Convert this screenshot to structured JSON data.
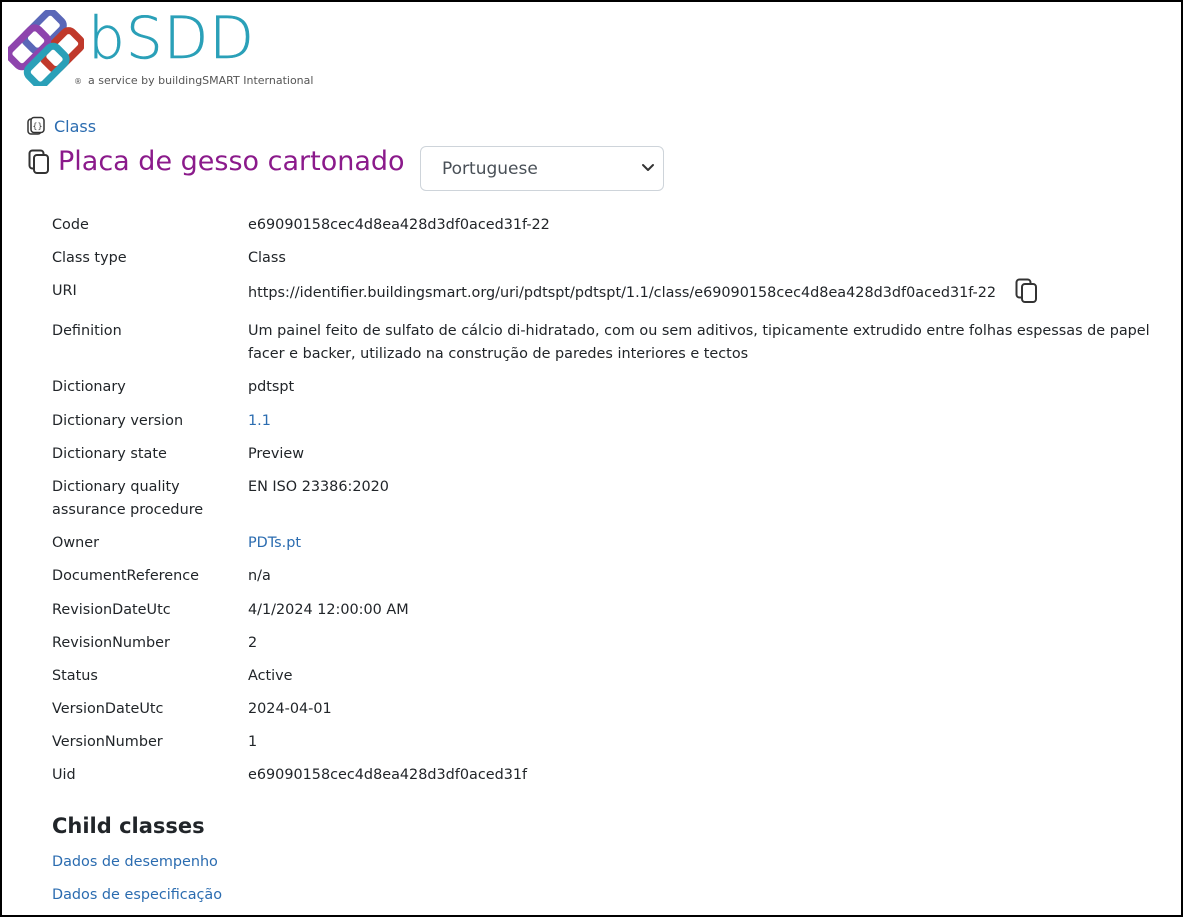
{
  "brand": {
    "name": "bSDD",
    "reg_mark": "®",
    "tagline": "a service by buildingSMART International"
  },
  "breadcrumb": {
    "label": "Class"
  },
  "class_title": "Placa de gesso cartonado",
  "language_select": {
    "selected": "Portuguese"
  },
  "properties": [
    {
      "key": "Code",
      "value": "e69090158cec4d8ea428d3df0aced31f-22"
    },
    {
      "key": "Class type",
      "value": "Class"
    },
    {
      "key": "URI",
      "value": "https://identifier.buildingsmart.org/uri/pdtspt/pdtspt/1.1/class/e69090158cec4d8ea428d3df0aced31f-22"
    },
    {
      "key": "Definition",
      "value": "Um painel feito de sulfato de cálcio di-hidratado, com ou sem aditivos, tipicamente extrudido entre folhas espessas de papel facer e backer, utilizado na construção de paredes interiores e tectos"
    },
    {
      "key": "Dictionary",
      "value": "pdtspt"
    },
    {
      "key": "Dictionary version",
      "value": "1.1"
    },
    {
      "key": "Dictionary state",
      "value": "Preview"
    },
    {
      "key": "Dictionary quality assurance procedure",
      "value": "EN ISO 23386:2020"
    },
    {
      "key": "Owner",
      "value": "PDTs.pt"
    },
    {
      "key": "DocumentReference",
      "value": "n/a"
    },
    {
      "key": "RevisionDateUtc",
      "value": "4/1/2024 12:00:00 AM"
    },
    {
      "key": "RevisionNumber",
      "value": "2"
    },
    {
      "key": "Status",
      "value": "Active"
    },
    {
      "key": "VersionDateUtc",
      "value": "2024-04-01"
    },
    {
      "key": "VersionNumber",
      "value": "1"
    },
    {
      "key": "Uid",
      "value": "e69090158cec4d8ea428d3df0aced31f"
    }
  ],
  "child_classes": {
    "heading": "Child classes",
    "items": [
      "Dados de desempenho",
      "Dados de especificação"
    ]
  },
  "colors": {
    "brand_teal": "#2aa0b8",
    "title_purple": "#8b1a8b",
    "link_blue": "#2b6cb0"
  }
}
